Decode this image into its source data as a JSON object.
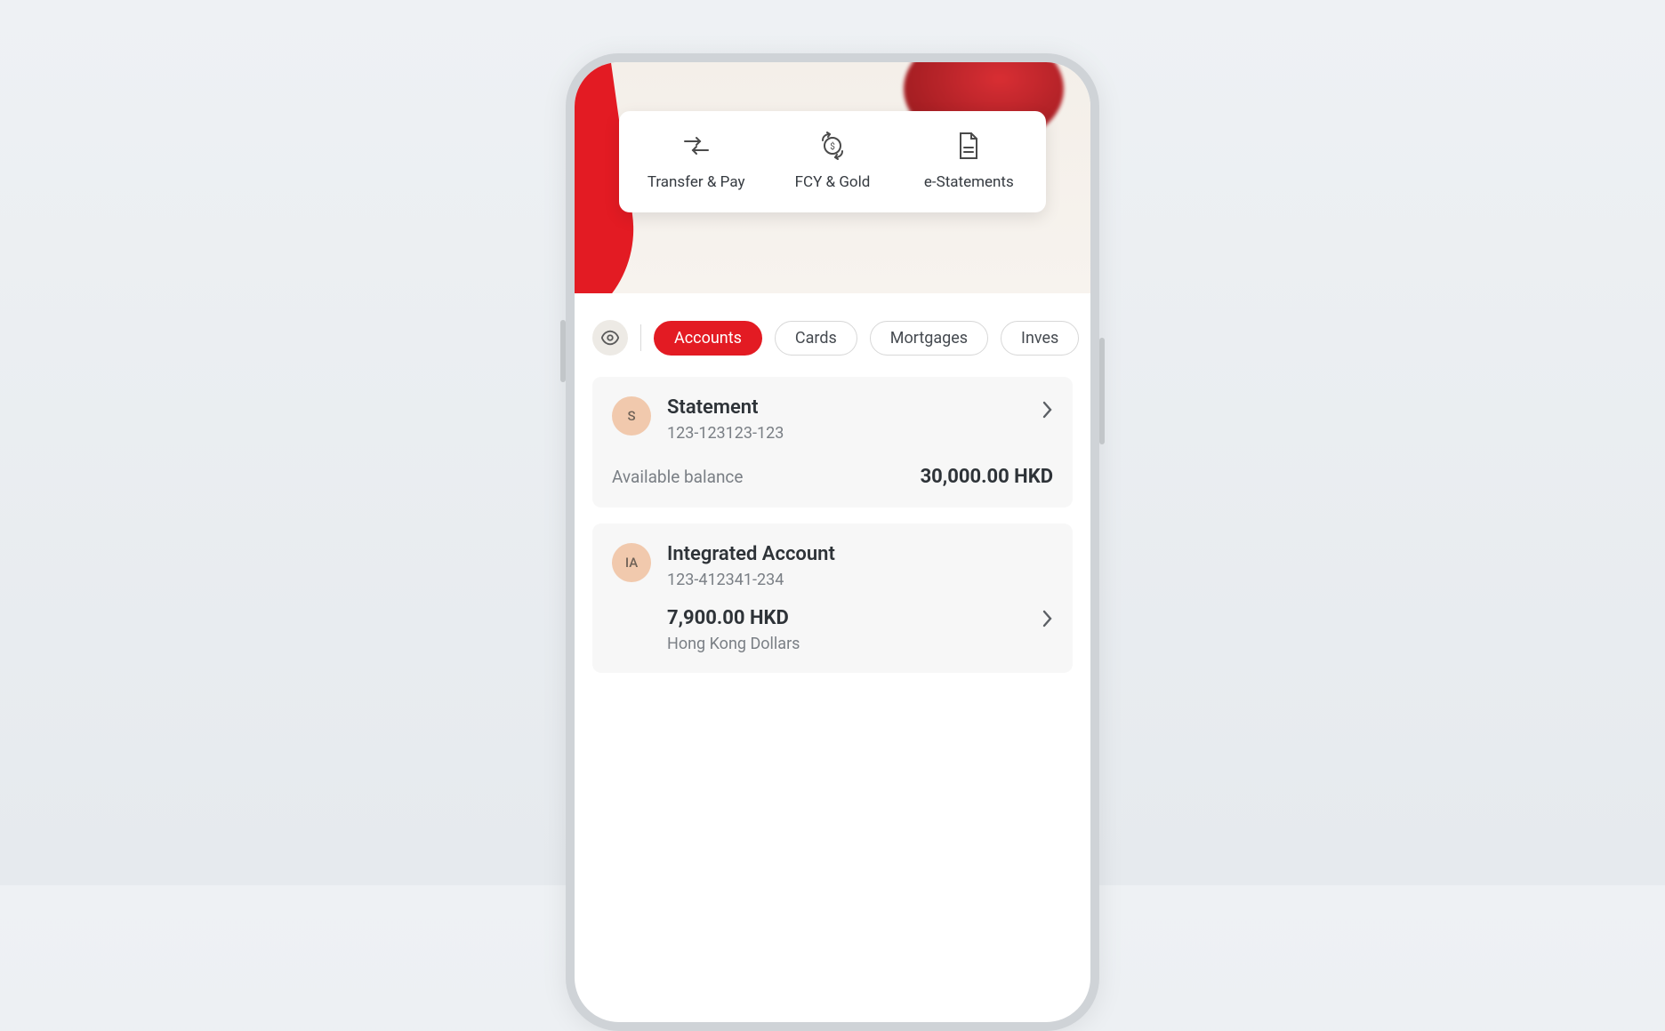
{
  "quick_actions": [
    {
      "label": "Transfer & Pay",
      "icon": "transfer-icon"
    },
    {
      "label": "FCY & Gold",
      "icon": "fcy-gold-icon"
    },
    {
      "label": "e-Statements",
      "icon": "document-icon"
    }
  ],
  "tabs": [
    {
      "label": "Accounts",
      "active": true
    },
    {
      "label": "Cards",
      "active": false
    },
    {
      "label": "Mortgages",
      "active": false
    },
    {
      "label": "Inves",
      "active": false
    }
  ],
  "accounts": [
    {
      "badge": "S",
      "title": "Statement",
      "number": "123-123123-123",
      "balance_label": "Available balance",
      "balance_value": "30,000.00 HKD"
    },
    {
      "badge": "IA",
      "title": "Integrated Account",
      "number": "123-412341-234",
      "amount": "7,900.00 HKD",
      "currency_desc": "Hong Kong Dollars"
    }
  ],
  "colors": {
    "brand_red": "#e31b23",
    "avatar_bg": "#f1c9ad"
  }
}
